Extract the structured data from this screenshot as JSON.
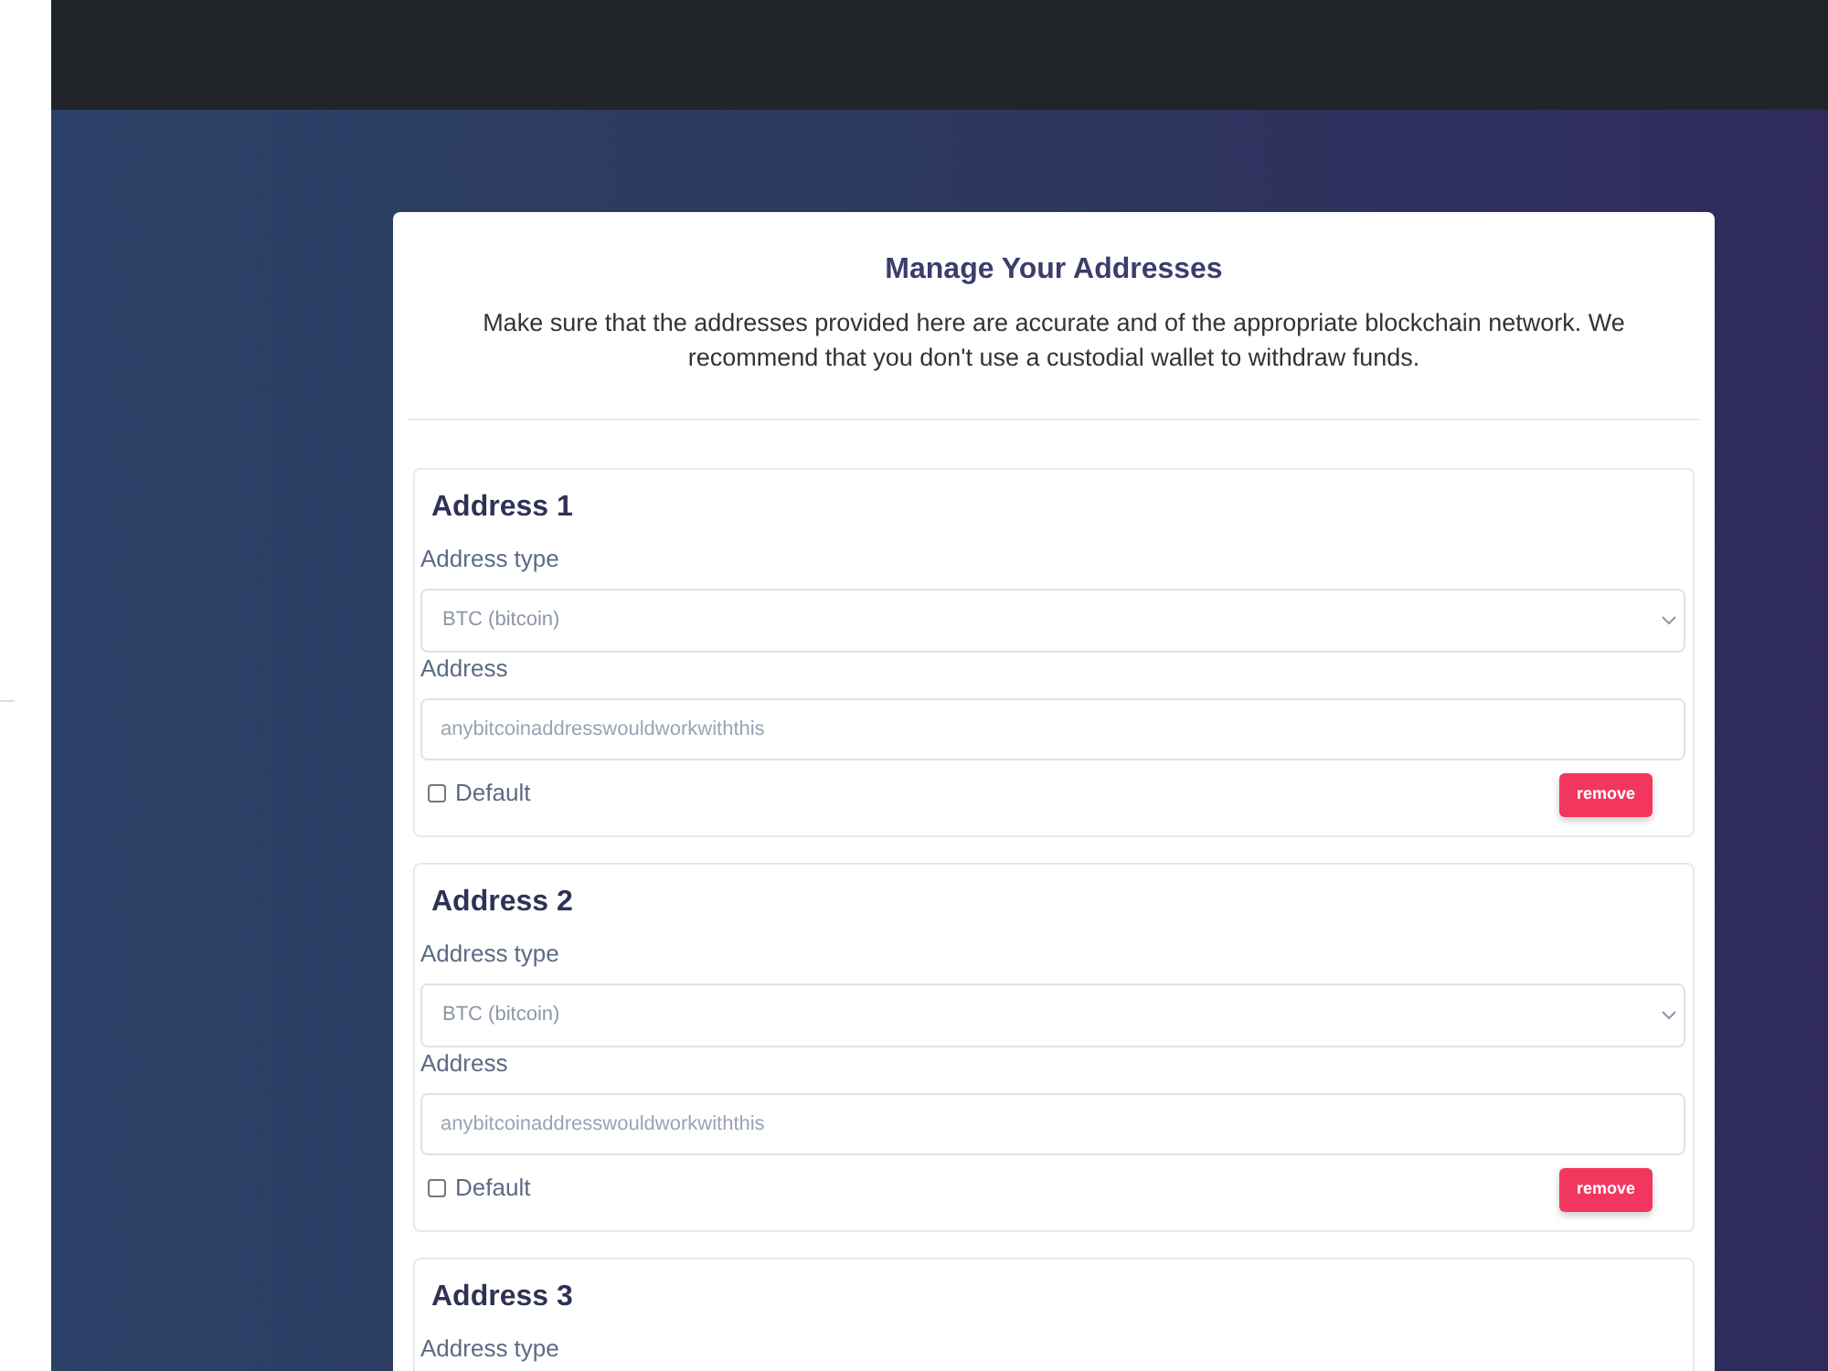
{
  "panel": {
    "title": "Manage Your Addresses",
    "description": "Make sure that the addresses provided here are accurate and of the appropriate blockchain network. We recommend that you don't use a custodial wallet to withdraw funds."
  },
  "addresses": [
    {
      "heading": "Address 1",
      "type_label": "Address type",
      "type_value": "BTC (bitcoin)",
      "address_label": "Address",
      "address_placeholder": "anybitcoinaddresswouldworkwiththis",
      "default_label": "Default",
      "default_checked": false,
      "remove_button": "remove"
    },
    {
      "heading": "Address 2",
      "type_label": "Address type",
      "type_value": "BTC (bitcoin)",
      "address_label": "Address",
      "address_placeholder": "anybitcoinaddresswouldworkwiththis",
      "default_label": "Default",
      "default_checked": false,
      "remove_button": "remove"
    },
    {
      "heading": "Address 3",
      "type_label": "Address type"
    }
  ]
}
